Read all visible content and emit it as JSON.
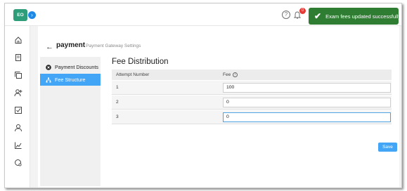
{
  "topbar": {
    "logo_text": "EO",
    "collapse_glyph": "›",
    "notification_count": "0",
    "toast_message": "Exam fees updated successfully"
  },
  "sidenav": {
    "items": [
      {
        "icon": "home-icon"
      },
      {
        "icon": "book-icon"
      },
      {
        "icon": "copy-icon"
      },
      {
        "icon": "add-user-icon"
      },
      {
        "icon": "checkbox-icon"
      },
      {
        "icon": "user-icon"
      },
      {
        "icon": "chart-icon"
      },
      {
        "icon": "settings-circle-icon"
      }
    ]
  },
  "header": {
    "title": "payment",
    "subtitle": "Payment Gateway Settings"
  },
  "leftmenu": {
    "items": [
      {
        "label": "Payment Discounts",
        "icon": "remove-circle-icon",
        "active": false
      },
      {
        "label": "Fee Structure",
        "icon": "hierarchy-icon",
        "active": true
      }
    ]
  },
  "fee_distribution": {
    "title": "Fee Distribution",
    "col_attempt": "Attempt Number",
    "col_fee": "Fee",
    "rows": [
      {
        "attempt": "1",
        "fee": "100"
      },
      {
        "attempt": "2",
        "fee": "0"
      },
      {
        "attempt": "3",
        "fee": "0"
      }
    ]
  },
  "actions": {
    "save_label": "Save"
  },
  "colors": {
    "accent": "#42a5f5",
    "toast": "#2e7d32",
    "logo": "#2e9d79"
  }
}
